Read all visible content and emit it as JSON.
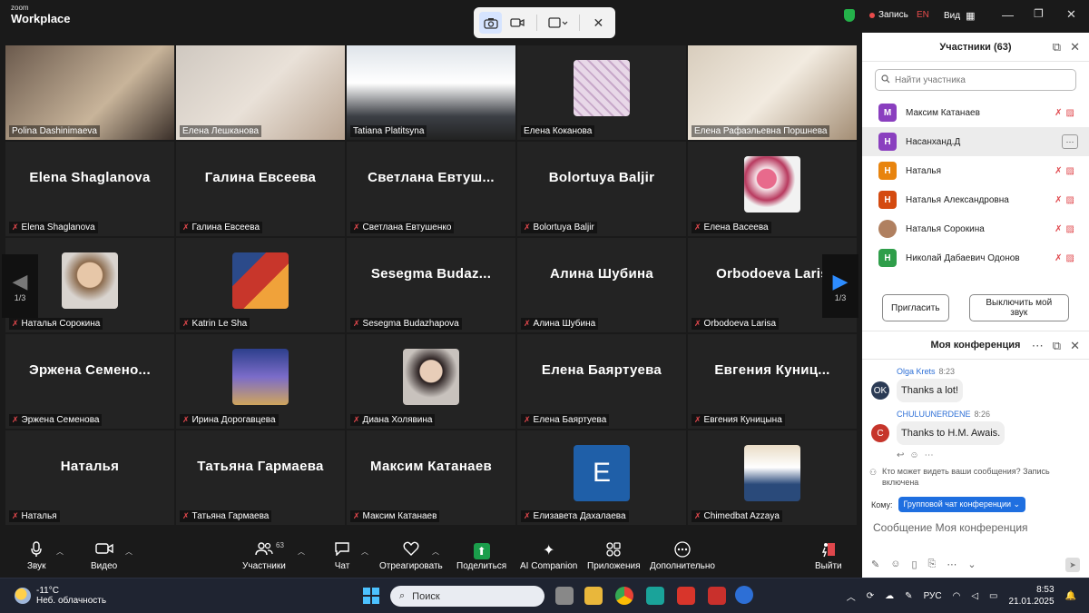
{
  "app": {
    "brand_small": "zoom",
    "brand_big": "Workplace"
  },
  "topbar": {
    "record_label": "Запись",
    "lang": "EN",
    "view_label": "Вид"
  },
  "tiles": [
    {
      "label": "Polina Dashinimaeva",
      "type": "video",
      "muted": false
    },
    {
      "label": "Елена Лешканова",
      "type": "video",
      "muted": false
    },
    {
      "label": "Tatiana Platitsyna",
      "type": "video",
      "muted": false
    },
    {
      "label": "Елена Коканова",
      "type": "avatar",
      "muted": false
    },
    {
      "label": "Елена Рафаэльевна Поршнева",
      "type": "video",
      "muted": false,
      "active": true
    },
    {
      "name": "Elena Shaglanova",
      "label": "Elena Shaglanova",
      "type": "name",
      "muted": true
    },
    {
      "name": "Галина Евсеева",
      "label": "Галина Евсеева",
      "type": "name",
      "muted": true
    },
    {
      "name": "Светлана  Евтуш...",
      "label": "Светлана Евтушенко",
      "type": "name",
      "muted": true
    },
    {
      "name": "Bolortuya Baljir",
      "label": "Bolortuya Baljir",
      "type": "name",
      "muted": true
    },
    {
      "label": "Елена Васеева",
      "type": "avatar",
      "muted": true
    },
    {
      "label": "Наталья Сорокина",
      "type": "avatar",
      "muted": true
    },
    {
      "label": "Katrin Le Sha",
      "type": "avatar",
      "muted": true
    },
    {
      "name": "Sesegma  Budaz...",
      "label": "Sesegma Budazhapova",
      "type": "name",
      "muted": true
    },
    {
      "name": "Алина Шубина",
      "label": "Алина Шубина",
      "type": "name",
      "muted": true
    },
    {
      "name": "Orbodoeva Laris",
      "label": "Orbodoeva Larisa",
      "type": "name",
      "muted": true
    },
    {
      "name": "Эржена  Семено...",
      "label": "Эржена Семенова",
      "type": "name",
      "muted": true
    },
    {
      "label": "Ирина Дорогавцева",
      "type": "avatar",
      "muted": true
    },
    {
      "label": "Диана Холявина",
      "type": "avatar",
      "muted": true
    },
    {
      "name": "Елена Баяртуева",
      "label": "Елена Баяртуева",
      "type": "name",
      "muted": true
    },
    {
      "name": "Евгения  Куниц...",
      "label": "Евгения Куницына",
      "type": "name",
      "muted": true
    },
    {
      "name": "Наталья",
      "label": "Наталья",
      "type": "name",
      "muted": true
    },
    {
      "name": "Татьяна Гармаева",
      "label": "Татьяна Гармаева",
      "type": "name",
      "muted": true
    },
    {
      "name": "Максим Катанаев",
      "label": "Максим Катанаев",
      "type": "name",
      "muted": true
    },
    {
      "letter": "E",
      "label": "Елизавета Дахалаева",
      "type": "letter",
      "muted": true
    },
    {
      "label": "Chimedbat Azzaya",
      "type": "avatar",
      "muted": true
    }
  ],
  "pager": {
    "left": "1/3",
    "right": "1/3"
  },
  "toolbar": {
    "audio": "Звук",
    "video": "Видео",
    "participants": "Участники",
    "participants_count": "63",
    "chat": "Чат",
    "react": "Отреагировать",
    "share": "Поделиться",
    "companion": "AI Companion",
    "apps": "Приложения",
    "more": "Дополнительно",
    "leave": "Выйти"
  },
  "participants_panel": {
    "title": "Участники (63)",
    "search_placeholder": "Найти участника",
    "items": [
      {
        "initial": "М",
        "name": "Максим Катанаев",
        "color": "#8a3fbf"
      },
      {
        "initial": "Н",
        "name": "Насанханд.Д",
        "color": "#8a3fbf",
        "selected": true
      },
      {
        "initial": "Н",
        "name": "Наталья",
        "color": "#e8840e"
      },
      {
        "initial": "Н",
        "name": "Наталья Александровна",
        "color": "#d44a10"
      },
      {
        "initial": "",
        "name": "Наталья Сорокина",
        "color": "#b08060"
      },
      {
        "initial": "Н",
        "name": "Николай Дабаевич Одонов",
        "color": "#2f9e4a"
      }
    ],
    "invite": "Пригласить",
    "mute_me": "Выключить мой звук"
  },
  "chat_panel": {
    "title": "Моя конференция",
    "messages": [
      {
        "sender": "Olga Krets",
        "time": "8:23",
        "text": "Thanks a lot!",
        "avatar": "OK",
        "color": "#2b3b55"
      },
      {
        "sender": "CHULUUNERDENE",
        "time": "8:26",
        "text": "Thanks to H.M. Awais.",
        "avatar": "C",
        "color": "#c6352b"
      }
    ],
    "visibility_notice": "Кто может видеть ваши сообщения? Запись включена",
    "to_label": "Кому:",
    "to_value": "Групповой чат конференции",
    "compose_placeholder": "Сообщение Моя конференция"
  },
  "taskbar": {
    "temp": "-11°C",
    "weather": "Неб. облачность",
    "search": "Поиск",
    "lang": "РУС",
    "time": "8:53",
    "date": "21.01.2025"
  }
}
